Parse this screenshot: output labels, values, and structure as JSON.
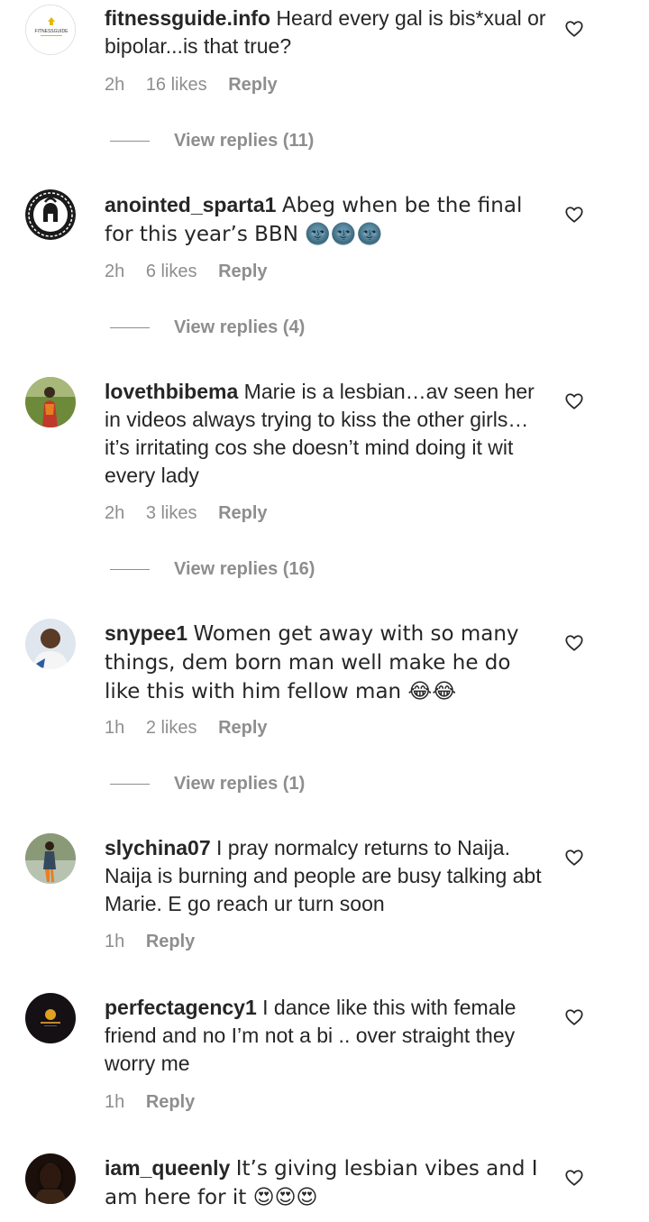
{
  "comments": [
    {
      "username": "fitnessguide.info",
      "text": "Heard every gal is bis*xual or bipolar...is that true?",
      "time": "2h",
      "likes": "16 likes",
      "reply": "Reply",
      "view_replies": "View replies (11)"
    },
    {
      "username": "anointed_sparta1",
      "text": "Abeg when be the final for this year’s BBN 🌚🌚🌚",
      "time": "2h",
      "likes": "6 likes",
      "reply": "Reply",
      "view_replies": "View replies (4)"
    },
    {
      "username": "lovethbibema",
      "text": "Marie is a lesbian…av seen her in videos always trying to kiss the other girls…it’s irritating cos she doesn’t mind doing it wit every lady",
      "time": "2h",
      "likes": "3 likes",
      "reply": "Reply",
      "view_replies": "View replies (16)"
    },
    {
      "username": "snypee1",
      "text": "Women get away with so many things, dem born man well make he do like this with him fellow man 😂😂",
      "time": "1h",
      "likes": "2 likes",
      "reply": "Reply",
      "view_replies": "View replies (1)"
    },
    {
      "username": "slychina07",
      "text": "I pray normalcy returns to Naija. Naija is burning and people are busy talking abt Marie. E go reach ur turn soon",
      "time": "1h",
      "reply": "Reply"
    },
    {
      "username": "perfectagency1",
      "text": "I dance like this with female friend and no I’m not a bi .. over straight they worry me",
      "time": "1h",
      "reply": "Reply"
    },
    {
      "username": "iam_queenly",
      "text": "It’s giving lesbian vibes and I am here for it 😍😍😍",
      "time": "",
      "reply": ""
    }
  ],
  "avatars": {
    "fitnessguide_logo_text": "FITNESSGUIDE"
  },
  "colors": {
    "text": "#262626",
    "secondary": "#8e8e8e",
    "background": "#ffffff"
  },
  "icons": {
    "like": "heart-outline-icon"
  }
}
